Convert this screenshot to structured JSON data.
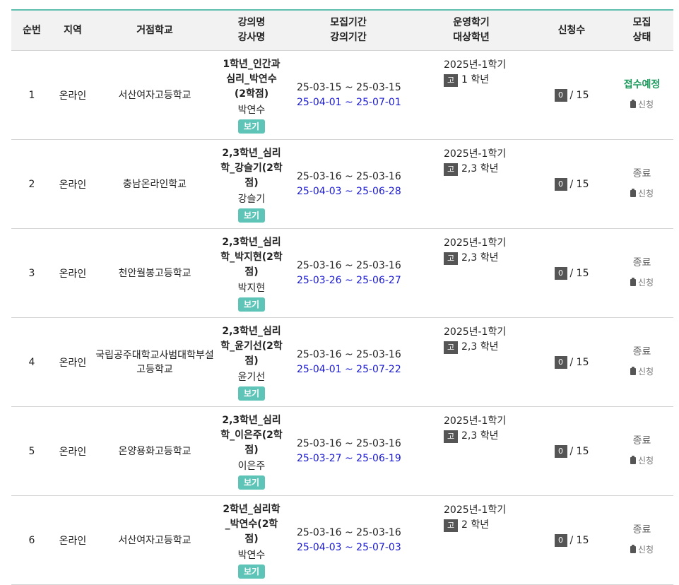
{
  "headers": {
    "no": "순번",
    "region": "지역",
    "school": "거점학교",
    "course_line1": "강의명",
    "course_line2": "강사명",
    "period_line1": "모집기간",
    "period_line2": "강의기간",
    "term_line1": "운영학기",
    "term_line2": "대상학년",
    "count": "신청수",
    "status_line1": "모집",
    "status_line2": "상태"
  },
  "view_label": "보기",
  "apply_label": "신청",
  "grade_badge": "고",
  "rows": [
    {
      "no": "1",
      "region": "온라인",
      "school": "서산여자고등학교",
      "course": "1학년_인간과 심리_박연수 (2학점)",
      "teacher": "박연수",
      "recruit": "25-03-15 ~ 25-03-15",
      "lecture": "25-04-01 ~ 25-07-01",
      "term": "2025년-1학기",
      "grade": "1 학년",
      "count": "0",
      "capacity": "/ 15",
      "status": "접수예정",
      "status_type": "open"
    },
    {
      "no": "2",
      "region": "온라인",
      "school": "충남온라인학교",
      "course": "2,3학년_심리학_강슬기(2학점)",
      "teacher": "강슬기",
      "recruit": "25-03-16 ~ 25-03-16",
      "lecture": "25-04-03 ~ 25-06-28",
      "term": "2025년-1학기",
      "grade": "2,3 학년",
      "count": "0",
      "capacity": "/ 15",
      "status": "종료",
      "status_type": "closed"
    },
    {
      "no": "3",
      "region": "온라인",
      "school": "천안월봉고등학교",
      "course": "2,3학년_심리학_박지현(2학점)",
      "teacher": "박지현",
      "recruit": "25-03-16 ~ 25-03-16",
      "lecture": "25-03-26 ~ 25-06-27",
      "term": "2025년-1학기",
      "grade": "2,3 학년",
      "count": "0",
      "capacity": "/ 15",
      "status": "종료",
      "status_type": "closed"
    },
    {
      "no": "4",
      "region": "온라인",
      "school": "국립공주대학교사범대학부설고등학교",
      "course": "2,3학년_심리학_윤기선(2학점)",
      "teacher": "윤기선",
      "recruit": "25-03-16 ~ 25-03-16",
      "lecture": "25-04-01 ~ 25-07-22",
      "term": "2025년-1학기",
      "grade": "2,3 학년",
      "count": "0",
      "capacity": "/ 15",
      "status": "종료",
      "status_type": "closed"
    },
    {
      "no": "5",
      "region": "온라인",
      "school": "온양용화고등학교",
      "course": "2,3학년_심리학_이은주(2학점)",
      "teacher": "이은주",
      "recruit": "25-03-16 ~ 25-03-16",
      "lecture": "25-03-27 ~ 25-06-19",
      "term": "2025년-1학기",
      "grade": "2,3 학년",
      "count": "0",
      "capacity": "/ 15",
      "status": "종료",
      "status_type": "closed"
    },
    {
      "no": "6",
      "region": "온라인",
      "school": "서산여자고등학교",
      "course": "2학년_심리학_박연수(2학점)",
      "teacher": "박연수",
      "recruit": "25-03-16 ~ 25-03-16",
      "lecture": "25-04-03 ~ 25-07-03",
      "term": "2025년-1학기",
      "grade": "2 학년",
      "count": "0",
      "capacity": "/ 15",
      "status": "종료",
      "status_type": "closed"
    }
  ]
}
